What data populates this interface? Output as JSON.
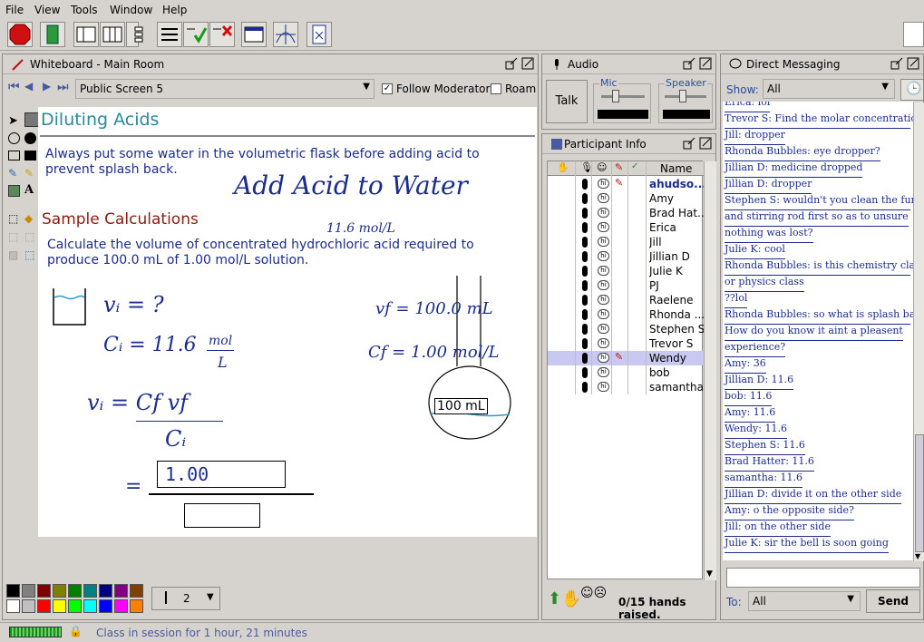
{
  "menu": [
    "File",
    "View",
    "Tools",
    "Window",
    "Help"
  ],
  "whiteboard": {
    "title": "Whiteboard - Main Room",
    "screen_select": "Public Screen 5",
    "follow_moderator": "Follow Moderator",
    "roam": "Roam",
    "heading": "Diluting Acids",
    "line1": "Always put some water in the volumetric flask before adding acid to",
    "line2": "prevent splash back.",
    "handwritten_title": "Add Acid to Water",
    "subheading": "Sample Calculations",
    "calc1": "Calculate the volume of concentrated hydrochloric acid required to",
    "calc2": "produce 100.0 mL of 1.00 mol/L solution.",
    "note_conc": "11.6 mol/L",
    "vi": "vᵢ = ?",
    "ci": "Cᵢ = 11.6",
    "ci_unit_top": "mol",
    "ci_unit_bot": "L",
    "vf": "vf = 100.0 mL",
    "cf": "Cf = 1.00 mol/L",
    "eq_num": "vᵢ = Cf vf",
    "eq_den": "Cᵢ",
    "box_value": "1.00",
    "equals": "=",
    "flask_label": "100 mL",
    "line_width": "2"
  },
  "audio": {
    "title": "Audio",
    "talk": "Talk",
    "mic": "Mic",
    "speaker": "Speaker"
  },
  "participants": {
    "title": "Participant Info",
    "col_name": "Name",
    "names": [
      "ahudso...",
      "Amy",
      "Brad Hat...",
      "Erica",
      "Jill",
      "Jillian D",
      "Julie K",
      "PJ",
      "Raelene",
      "Rhonda ...",
      "Stephen S",
      "Trevor S",
      "Wendy",
      "bob",
      "samantha"
    ],
    "hands": "0/15 hands raised."
  },
  "messaging": {
    "title": "Direct Messaging",
    "show_label": "Show:",
    "show_value": "All",
    "to_label": "To:",
    "to_value": "All",
    "send": "Send",
    "lines": [
      "Erica: lol",
      "Trevor S: Find the molar concentration?",
      "Jill: dropper",
      "Rhonda Bubbles: eye dropper?",
      "Jillian D: medicine dropped",
      "Jillian D: dropper",
      "Stephen S: wouldn't you clean the funnel",
      "and stirring rod first so as to unsure",
      "nothing was lost?",
      "Julie K: cool",
      "Rhonda Bubbles: is this chemistry class",
      "or physics class",
      "??lol",
      "Rhonda Bubbles: so what is splash back?",
      "How do you know it aint a pleasent",
      "experience?",
      "Amy: 36",
      "Jillian D: 11.6",
      "bob: 11.6",
      "Amy: 11.6",
      "Wendy: 11.6",
      "Stephen S: 11.6",
      "Brad Hatter: 11.6",
      "samantha: 11.6",
      "Jillian D: divide it on the other side",
      "Amy: o the opposite side?",
      "Jill: on the other side",
      "Julie K: sir the bell is soon going"
    ]
  },
  "status": "Class in session for 1 hour, 21 minutes",
  "colors": {
    "accent_teal": "#2a8a9a",
    "heading_red": "#8a1c10",
    "text_blue": "#1c2c8c",
    "selected_row": "#c8c8f0"
  }
}
